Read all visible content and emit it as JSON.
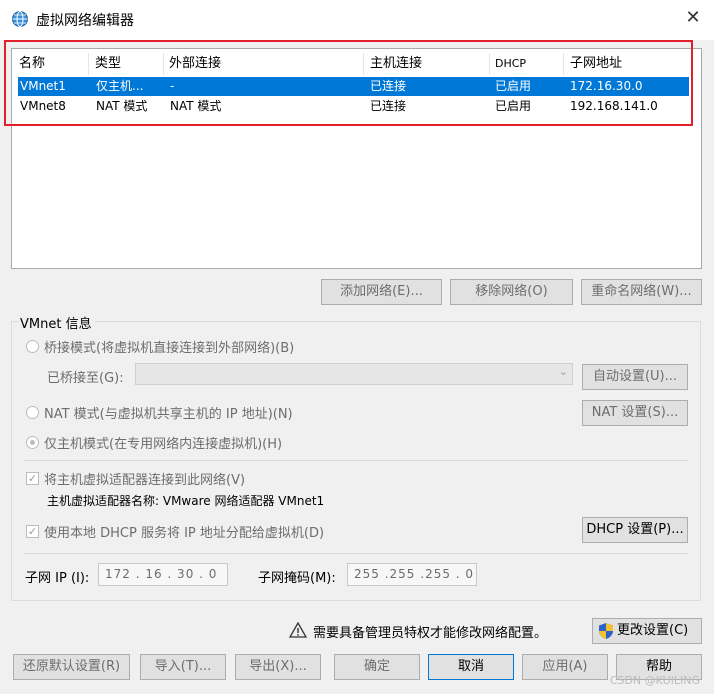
{
  "window": {
    "title": "虚拟网络编辑器",
    "close_glyph": "✕"
  },
  "table": {
    "headers": [
      "名称",
      "类型",
      "外部连接",
      "主机连接",
      "DHCP",
      "子网地址"
    ],
    "rows": [
      [
        "VMnet1",
        "仅主机...",
        "-",
        "已连接",
        "已启用",
        "172.16.30.0"
      ],
      [
        "VMnet8",
        "NAT 模式",
        "NAT 模式",
        "已连接",
        "已启用",
        "192.168.141.0"
      ]
    ],
    "selected_row": 0
  },
  "list_buttons": {
    "add": "添加网络(E)...",
    "remove": "移除网络(O)",
    "rename": "重命名网络(W)..."
  },
  "vmnet_info": {
    "group_label": "VMnet 信息",
    "bridged_label": "桥接模式(将虚拟机直接连接到外部网络)(B)",
    "bridged_to_label": "已桥接至(G):",
    "auto_settings": "自动设置(U)...",
    "nat_label": "NAT 模式(与虚拟机共享主机的 IP 地址)(N)",
    "nat_settings": "NAT 设置(S)...",
    "hostonly_label": "仅主机模式(在专用网络内连接虚拟机)(H)",
    "connect_adapter_label": "将主机虚拟适配器连接到此网络(V)",
    "adapter_name_text": "主机虚拟适配器名称: VMware 网络适配器 VMnet1",
    "dhcp_label": "使用本地 DHCP 服务将 IP 地址分配给虚拟机(D)",
    "dhcp_settings": "DHCP 设置(P)...",
    "subnet_ip_label": "子网 IP (I):",
    "subnet_ip_value": "172 . 16 . 30 . 0",
    "subnet_mask_label": "子网掩码(M):",
    "subnet_mask_value": "255 .255 .255 . 0"
  },
  "admin_notice": {
    "text": "需要具备管理员特权才能修改网络配置。",
    "change_settings": "更改设置(C)"
  },
  "bottom_buttons": {
    "restore": "还原默认设置(R)",
    "import": "导入(T)...",
    "export": "导出(X)...",
    "ok": "确定",
    "cancel": "取消",
    "apply": "应用(A)",
    "help": "帮助"
  },
  "watermark": "CSDN @KUILING",
  "colors": {
    "selection": "#0078d7",
    "highlight_box": "#e0202a",
    "disabled_text": "#6d6d6d"
  }
}
